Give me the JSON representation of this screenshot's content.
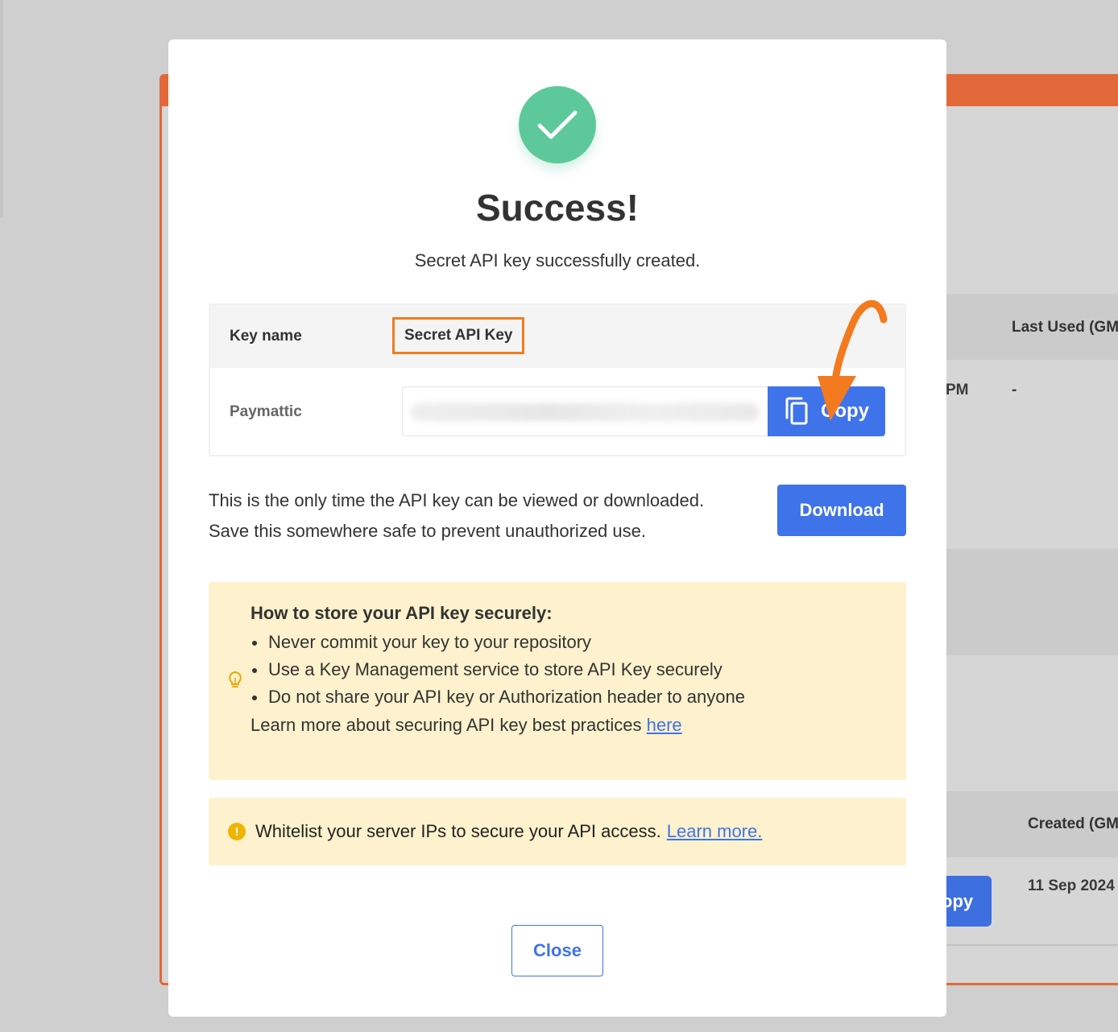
{
  "background": {
    "col_last_used": "Last Used (GM",
    "row_time_suffix": "PM",
    "row_last_used": "-",
    "col_created": "Created (GM",
    "row_created": "11 Sep 2024",
    "copy_fragment": "opy"
  },
  "modal": {
    "title": "Success!",
    "subtitle": "Secret API key successfully created.",
    "key_table": {
      "header_label": "Key name",
      "header_value": "Secret API Key",
      "row_label": "Paymattic",
      "copy_label": "Copy"
    },
    "note_line1": "This is the only time the API key can be viewed or downloaded.",
    "note_line2": "Save this somewhere safe to prevent unauthorized use.",
    "download_label": "Download",
    "tips": {
      "title": "How to store your API key securely:",
      "items": [
        "Never commit your key to your repository",
        "Use a Key Management service to store API Key securely",
        "Do not share your API key or Authorization header to anyone"
      ],
      "learn_text": "Learn more about securing API key best practices",
      "learn_link": "here"
    },
    "warning": {
      "text": "Whitelist your server IPs to secure your API access.",
      "link": "Learn more."
    },
    "close_label": "Close"
  },
  "colors": {
    "primary": "#3f73ea",
    "success": "#5dc99a",
    "highlight": "#ee7d1f",
    "tip_bg": "#fdf2cd",
    "warning_icon": "#f0b400",
    "background_accent": "#e2683a"
  },
  "icons": {
    "success": "checkmark-icon",
    "copy": "copy-icon",
    "tip": "lightbulb-icon",
    "warning": "exclamation-icon",
    "annotation": "arrow-annotation-icon"
  }
}
